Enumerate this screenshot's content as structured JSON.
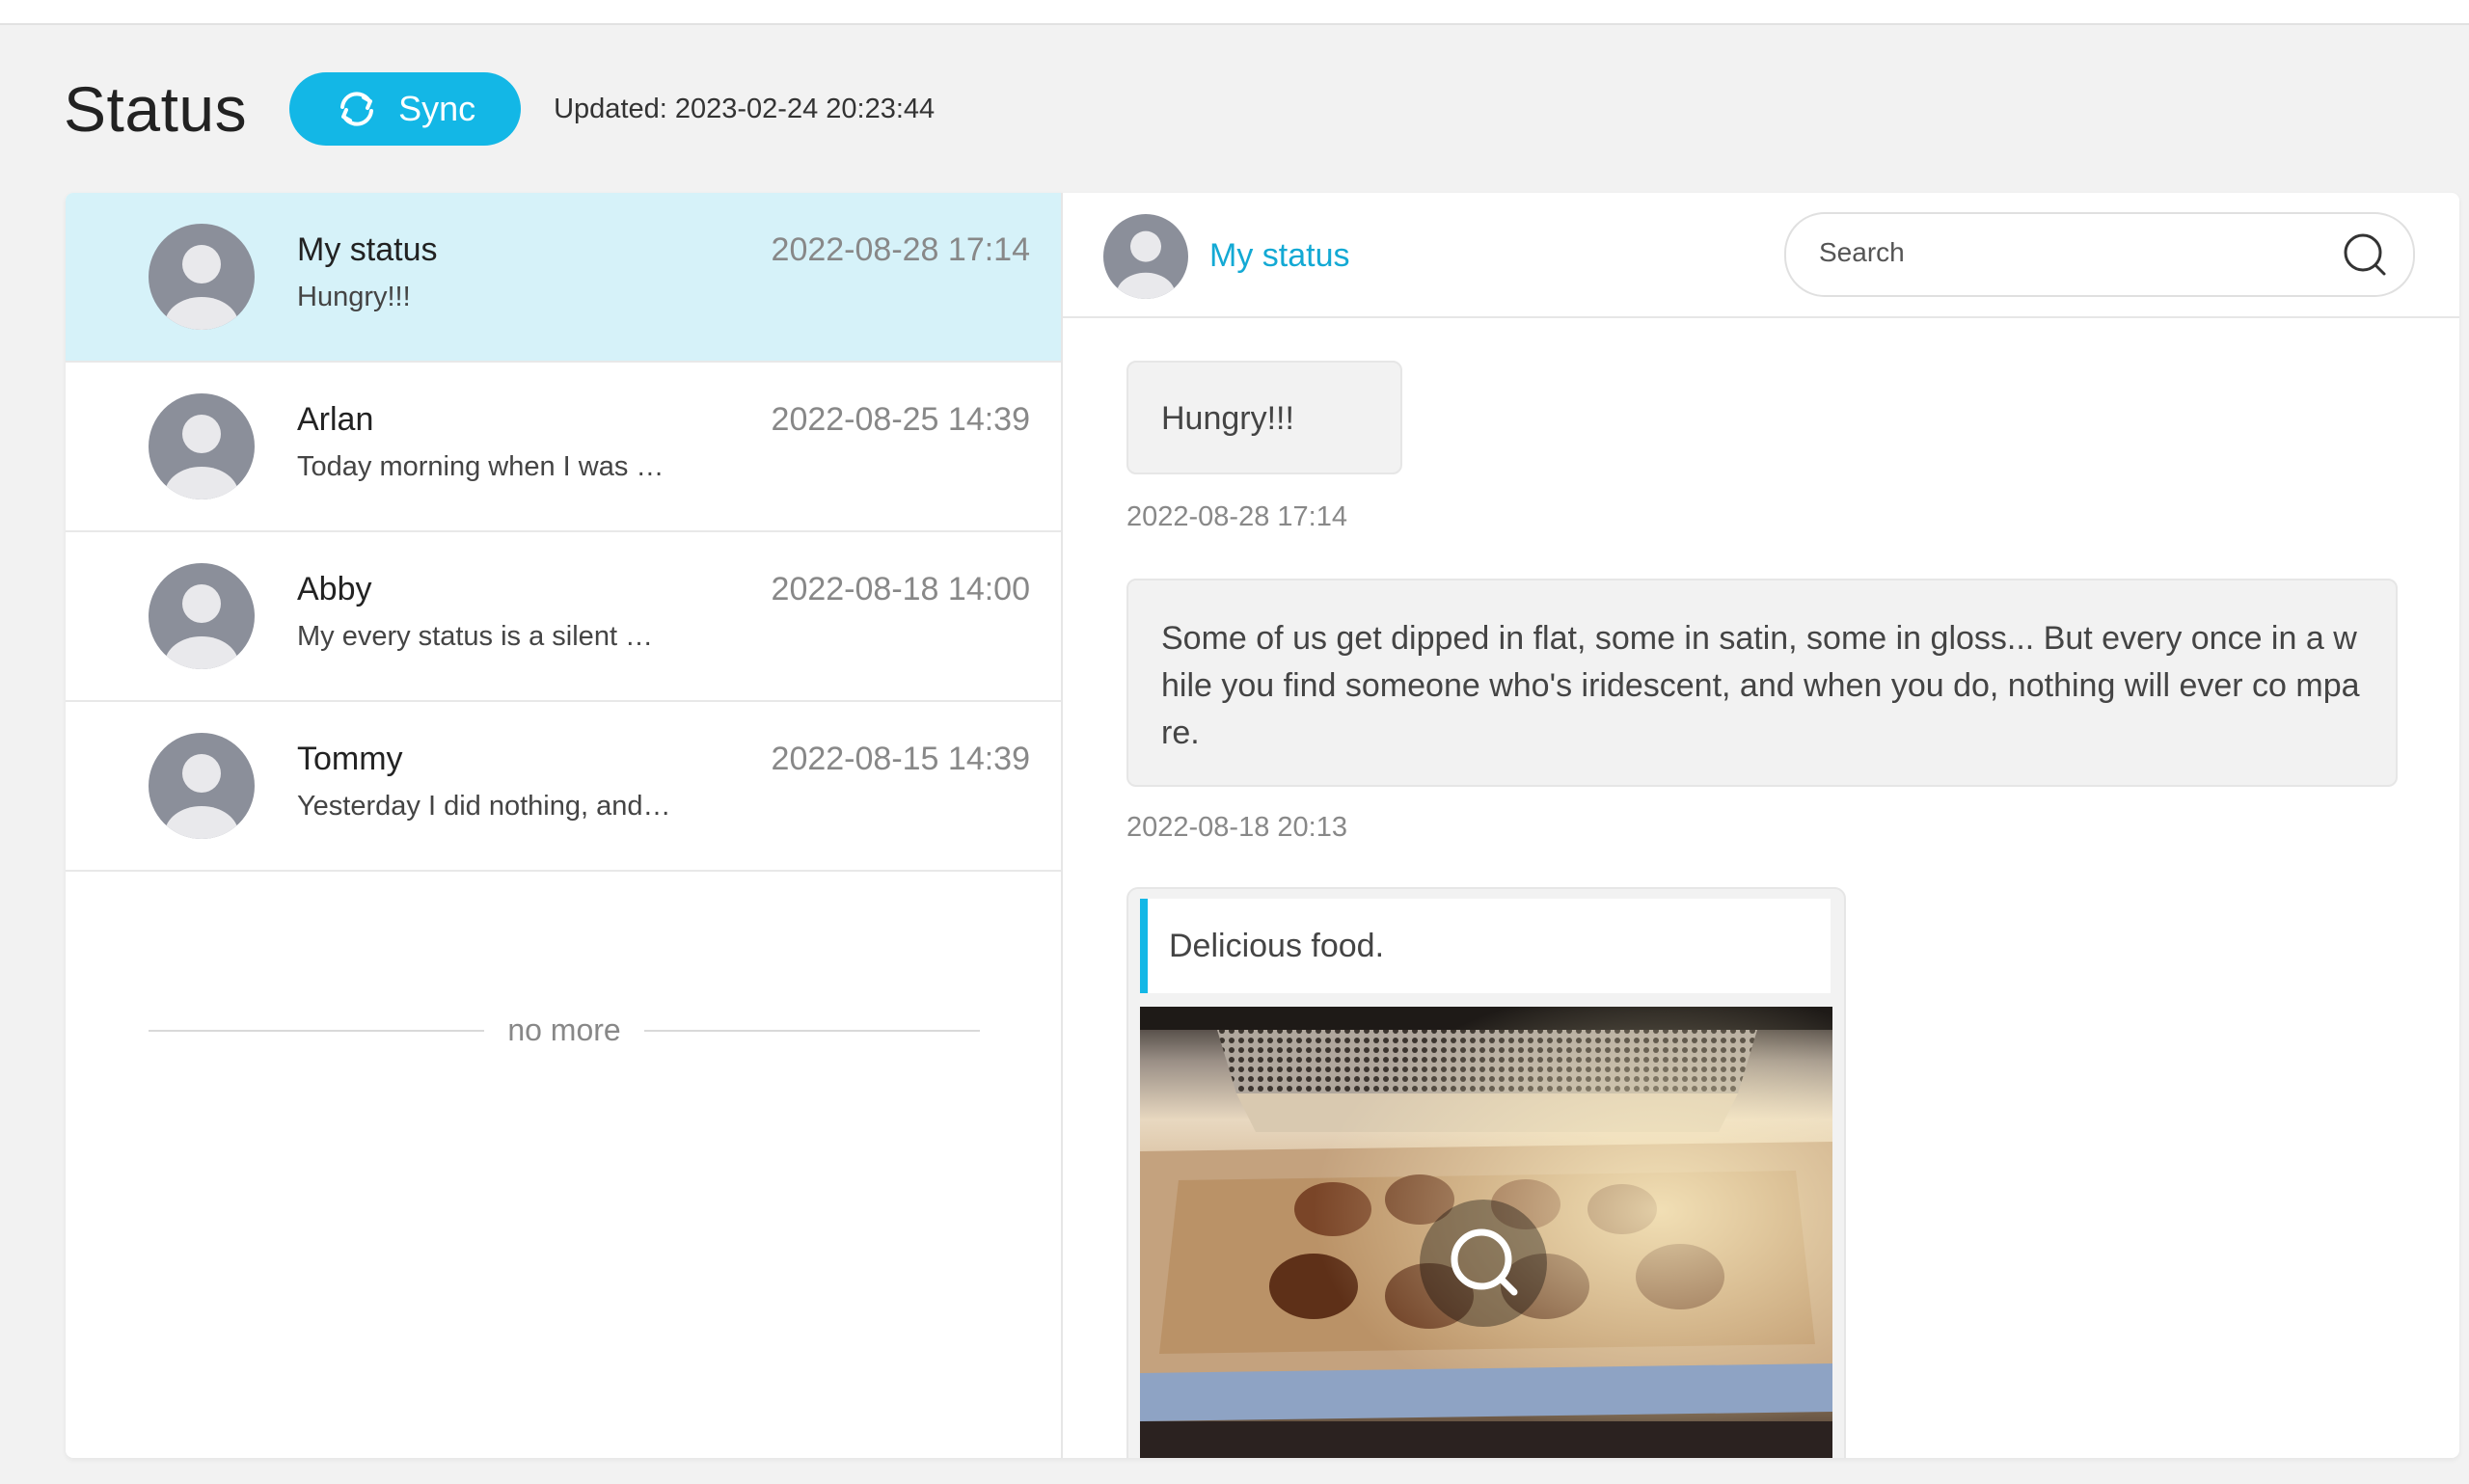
{
  "header": {
    "title": "Status",
    "sync_label": "Sync",
    "updated": "Updated: 2023-02-24 20:23:44"
  },
  "colors": {
    "accent": "#13b7e6",
    "active_row": "#d6f2f9",
    "avatar": "#8b8f9a"
  },
  "statuses": [
    {
      "name": "My status",
      "preview": "Hungry!!!",
      "time": "2022-08-28 17:14",
      "active": true
    },
    {
      "name": "Arlan",
      "preview": "Today morning when I was …",
      "time": "2022-08-25 14:39",
      "active": false
    },
    {
      "name": "Abby",
      "preview": "My every status is a silent …",
      "time": "2022-08-18 14:00",
      "active": false
    },
    {
      "name": "Tommy",
      "preview": "Yesterday I did nothing, and…",
      "time": "2022-08-15 14:39",
      "active": false
    }
  ],
  "list_footer": "no more",
  "detail": {
    "title": "My status",
    "search_placeholder": "Search",
    "posts": [
      {
        "text": "Hungry!!!",
        "time": "2022-08-28 17:14"
      },
      {
        "text": "Some of us get dipped in flat, some in satin, some in gloss... But every once in a while you find someone who's iridescent, and when you do, nothing will ever co mpare.",
        "time": "2022-08-18 20:13"
      },
      {
        "caption": "Delicious food.",
        "image": "food-photo",
        "action_icon": "zoom-icon"
      }
    ]
  }
}
